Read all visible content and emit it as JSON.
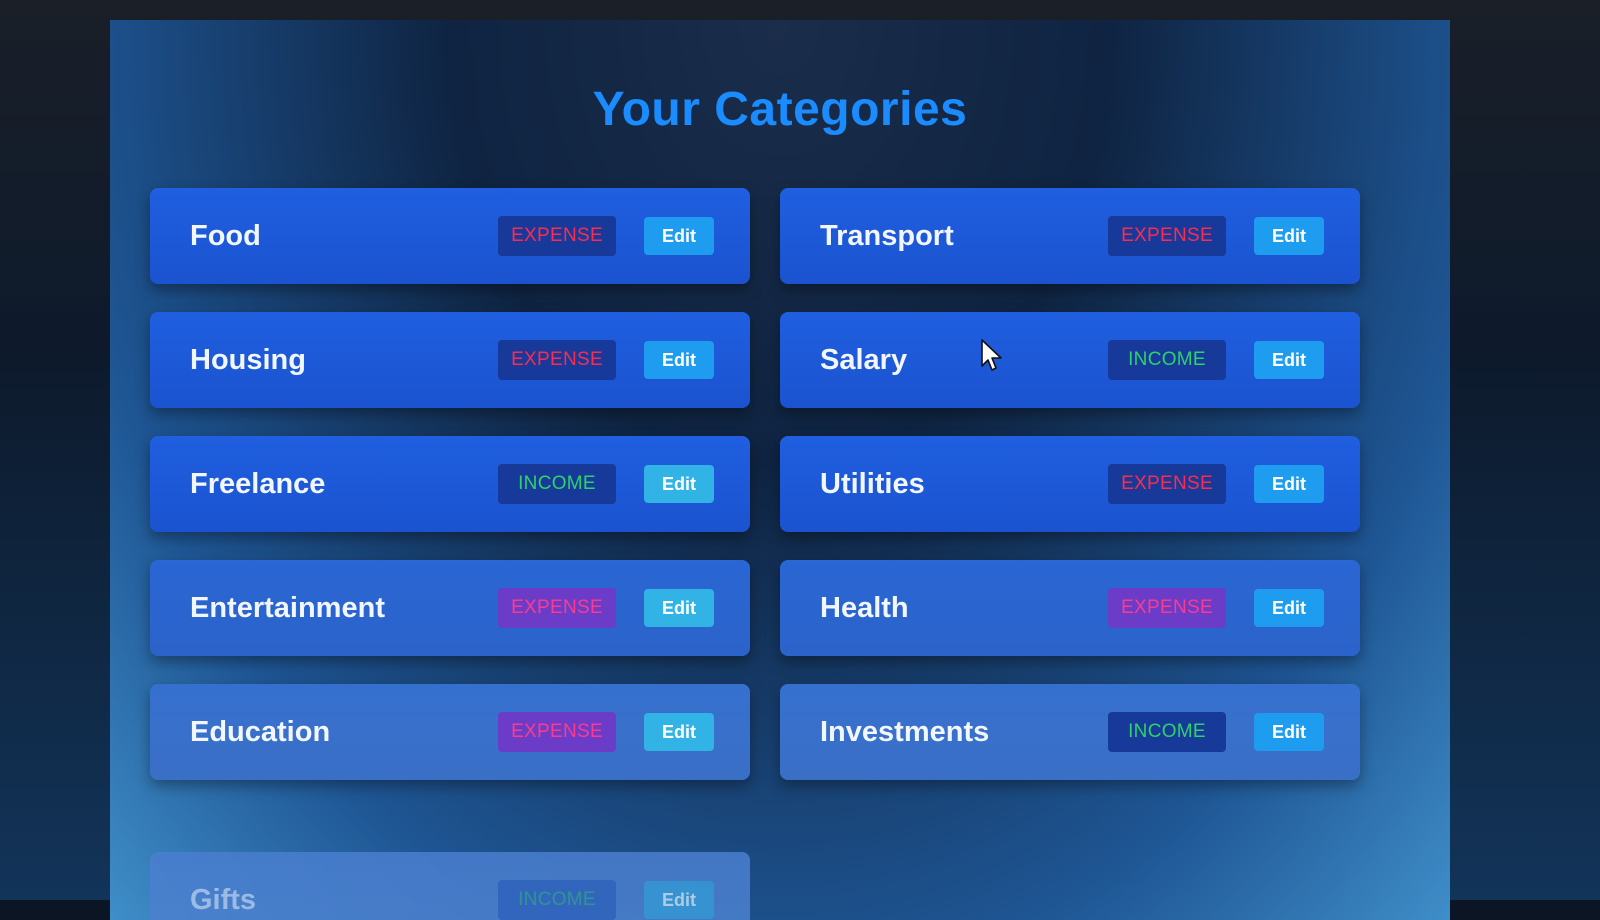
{
  "page": {
    "title": "Your Categories"
  },
  "categories": [
    {
      "name": "Food",
      "type": "EXPENSE",
      "edit_label": "Edit"
    },
    {
      "name": "Transport",
      "type": "EXPENSE",
      "edit_label": "Edit"
    },
    {
      "name": "Housing",
      "type": "EXPENSE",
      "edit_label": "Edit"
    },
    {
      "name": "Salary",
      "type": "INCOME",
      "edit_label": "Edit"
    },
    {
      "name": "Freelance",
      "type": "INCOME",
      "edit_label": "Edit"
    },
    {
      "name": "Utilities",
      "type": "EXPENSE",
      "edit_label": "Edit"
    },
    {
      "name": "Entertainment",
      "type": "EXPENSE",
      "edit_label": "Edit"
    },
    {
      "name": "Health",
      "type": "EXPENSE",
      "edit_label": "Edit"
    },
    {
      "name": "Education",
      "type": "EXPENSE",
      "edit_label": "Edit"
    },
    {
      "name": "Investments",
      "type": "INCOME",
      "edit_label": "Edit"
    },
    {
      "name": "Gifts",
      "type": "INCOME",
      "edit_label": "Edit"
    }
  ],
  "colors": {
    "title": "#1a8cff",
    "card": "#1f5fe0",
    "expense_text": "#ff2a4d",
    "income_text": "#2cd26a",
    "edit_button": "#1e9df0"
  },
  "icons": {
    "cursor": "mouse-pointer-icon"
  }
}
